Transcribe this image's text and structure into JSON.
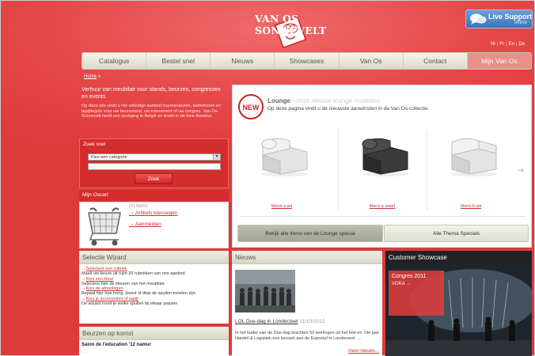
{
  "brand": {
    "name": "VAN OS SONNEVELT"
  },
  "live_support": {
    "title": "Live Support",
    "status": "offline"
  },
  "languages": [
    "Nl",
    "Fr",
    "En",
    "De"
  ],
  "nav": {
    "items": [
      "Catalogus",
      "Bestel snel",
      "Nieuws",
      "Showcases",
      "Van Os",
      "Contact",
      "Mijn Van Os"
    ]
  },
  "breadcrumb": {
    "home": "Home",
    "sep": "»"
  },
  "intro": {
    "heading": "Verhuur van meubilair voor stands, beurzen, congressen en events",
    "text": "Op deze site vindt u het volledige aanbod huurmeubelen, toebehoren en tapijttegels voor uw beursstand, uw evenement of uw congres. Van Os-Sonnevelt heeft een vestiging in België en levert in de hele Benelux."
  },
  "search": {
    "title": "Zoek snel",
    "select": "Kies een categorie",
    "button": "Zoek"
  },
  "cart": {
    "title": "Mijn Oscart",
    "items": "(0) Items",
    "add": "Artikels toevoegen",
    "quote": "Aanmelden"
  },
  "lounge": {
    "badge": "NEW",
    "title": "Lounge",
    "tagline": "- onze nieuwe lounge-modellen",
    "subtitle": "Op deze pagina vindt u de nieuwste aanwinsten in de Van Os-collectie.",
    "products": [
      "Mervi a wit",
      "Mervi a zwart",
      "Mervi b wit"
    ],
    "button_all": "Bekijk alle items van de Lounge special",
    "button_themes": "Alle Thema Specials"
  },
  "wizard": {
    "title": "Selectie Wizard",
    "steps": [
      {
        "link": "Selecteer een rubriek",
        "text": "Maak uw keuze uit ruim 20 rubrieken van ons aanbod."
      },
      {
        "link": "Kies een kleur",
        "text": "Selecteer hier de kleuren van het meubilair."
      },
      {
        "link": "Kies de afmetingen",
        "text": "Bepaal hier hoe hoog, breed of diep de spullen moeten zijn."
      },
      {
        "link": "Kies je accessoires of tapijt",
        "text": "De wizard toont je welke spullen bij elkaar passen."
      }
    ]
  },
  "beurzen": {
    "title": "Beurzen op komst",
    "item": "Salon de l'education '12 namur",
    "sub": "..."
  },
  "news": {
    "title": "Nieuws",
    "headline": "LOL Doe-dag in Londerzeel",
    "date": "11/10/2012",
    "text": "In het kader van de Doe-dag brachten 50 leerlingen uit het 6de en 7de jaar Handel & Logistiek een bezoek aan de Expostal in Londerzeel.",
    "arrow": "→",
    "more": "meer nieuws..."
  },
  "showcase": {
    "title": "Customer Showcase",
    "event": "Congres 2011",
    "client": "VOKA"
  }
}
